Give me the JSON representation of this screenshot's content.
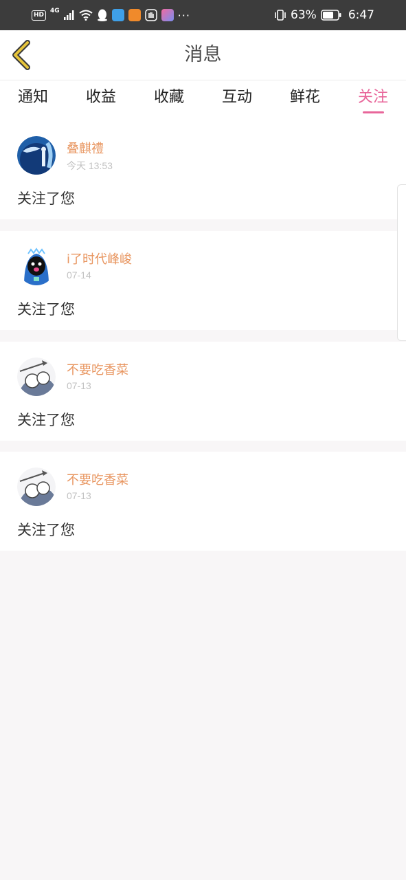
{
  "status_bar": {
    "hd": "HD",
    "network": "4G",
    "battery_percent": "63%",
    "time": "6:47",
    "icons": [
      "signal-icon",
      "wifi-icon",
      "qq-icon",
      "browser-icon",
      "video-app-icon",
      "hand-icon",
      "flower-app-icon",
      "more-dots-icon",
      "vibrate-icon",
      "battery-icon"
    ]
  },
  "header": {
    "title": "消息",
    "back_icon": "chevron-left-icon"
  },
  "tabs": [
    {
      "label": "通知"
    },
    {
      "label": "收益"
    },
    {
      "label": "收藏"
    },
    {
      "label": "互动"
    },
    {
      "label": "鲜花"
    },
    {
      "label": "关注",
      "active": true
    }
  ],
  "messages": [
    {
      "name": "叠麒禮",
      "time": "今天 13:53",
      "text": "关注了您",
      "avatar": "avatar-1"
    },
    {
      "name": "i了时代峰峻",
      "time": "07-14",
      "text": "关注了您",
      "avatar": "avatar-2"
    },
    {
      "name": "不要吃香菜",
      "time": "07-13",
      "text": "关注了您",
      "avatar": "avatar-3"
    },
    {
      "name": "不要吃香菜",
      "time": "07-13",
      "text": "关注了您",
      "avatar": "avatar-3"
    }
  ],
  "colors": {
    "accent": "#e8669a",
    "name": "#e8955f",
    "back_arrow": "#e6c43a"
  }
}
